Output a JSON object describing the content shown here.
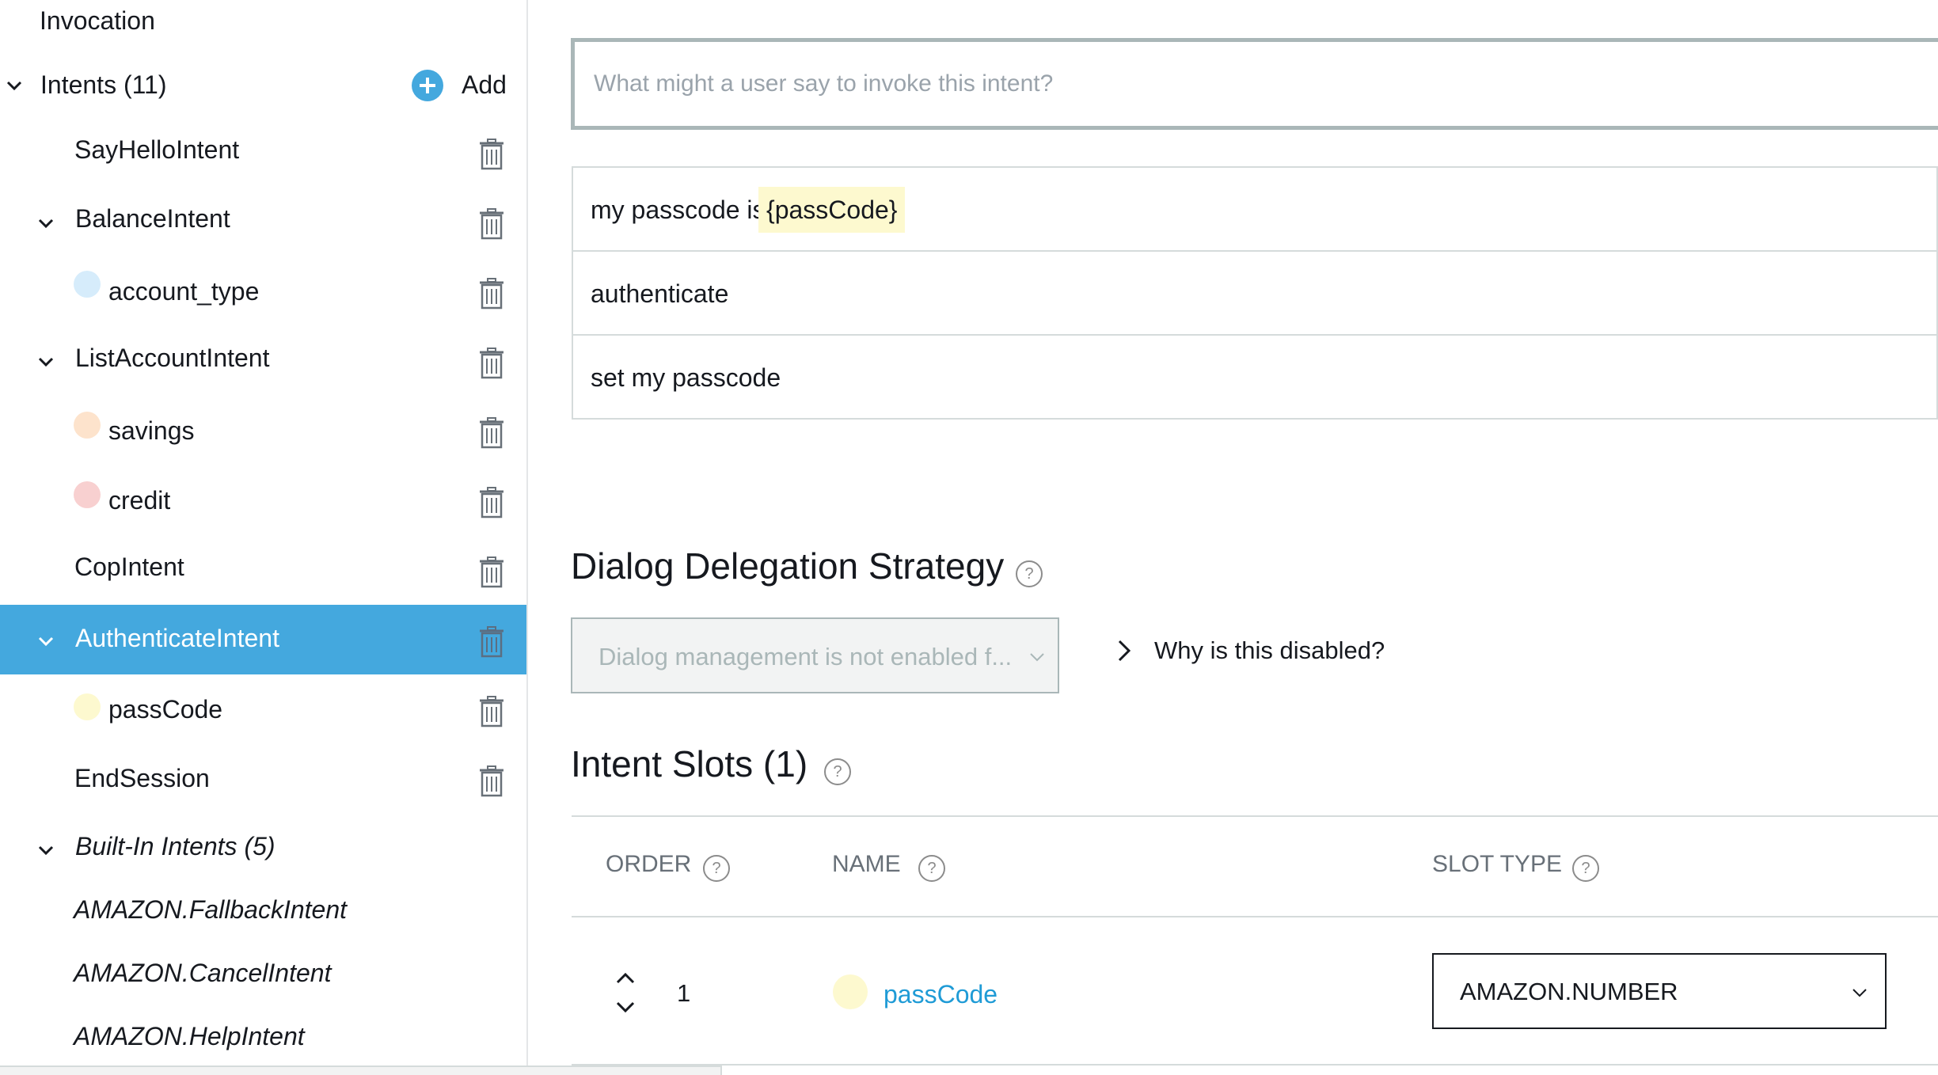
{
  "sidebar": {
    "invocation_label": "Invocation",
    "intents_label": "Intents (11)",
    "add_label": "Add",
    "items": [
      {
        "label": "SayHelloIntent"
      },
      {
        "label": "BalanceIntent"
      },
      {
        "label": "account_type",
        "dot_color": "#d6ecfb"
      },
      {
        "label": "ListAccountIntent"
      },
      {
        "label": "savings",
        "dot_color": "#fde3cc"
      },
      {
        "label": "credit",
        "dot_color": "#f8d0d0"
      },
      {
        "label": "CopIntent"
      },
      {
        "label": "AuthenticateIntent",
        "selected": true
      },
      {
        "label": "passCode",
        "dot_color": "#fdf9cf"
      },
      {
        "label": "EndSession"
      }
    ],
    "builtin_label": "Built-In Intents (5)",
    "builtin_items": [
      {
        "label": "AMAZON.FallbackIntent"
      },
      {
        "label": "AMAZON.CancelIntent"
      },
      {
        "label": "AMAZON.HelpIntent"
      }
    ]
  },
  "main": {
    "utterance_input_placeholder": "What might a user say to invoke this intent?",
    "utterances": [
      {
        "prefix": "my passcode is",
        "slot": "{passCode}"
      },
      {
        "prefix": "authenticate"
      },
      {
        "prefix": "set my passcode"
      }
    ],
    "dialog_heading": "Dialog Delegation Strategy",
    "dialog_select_value": "Dialog management is not enabled f...",
    "why_disabled_label": "Why is this disabled?",
    "slots_heading": "Intent Slots (1)",
    "slots_table": {
      "columns": [
        "ORDER",
        "NAME",
        "SLOT TYPE"
      ],
      "rows": [
        {
          "order": "1",
          "name": "passCode",
          "slot_type": "AMAZON.NUMBER",
          "dot_color": "#fdf9cf"
        }
      ]
    }
  },
  "colors": {
    "accent": "#44a8de",
    "link": "#0073bb",
    "slot_highlight": "#fdf9cf"
  }
}
